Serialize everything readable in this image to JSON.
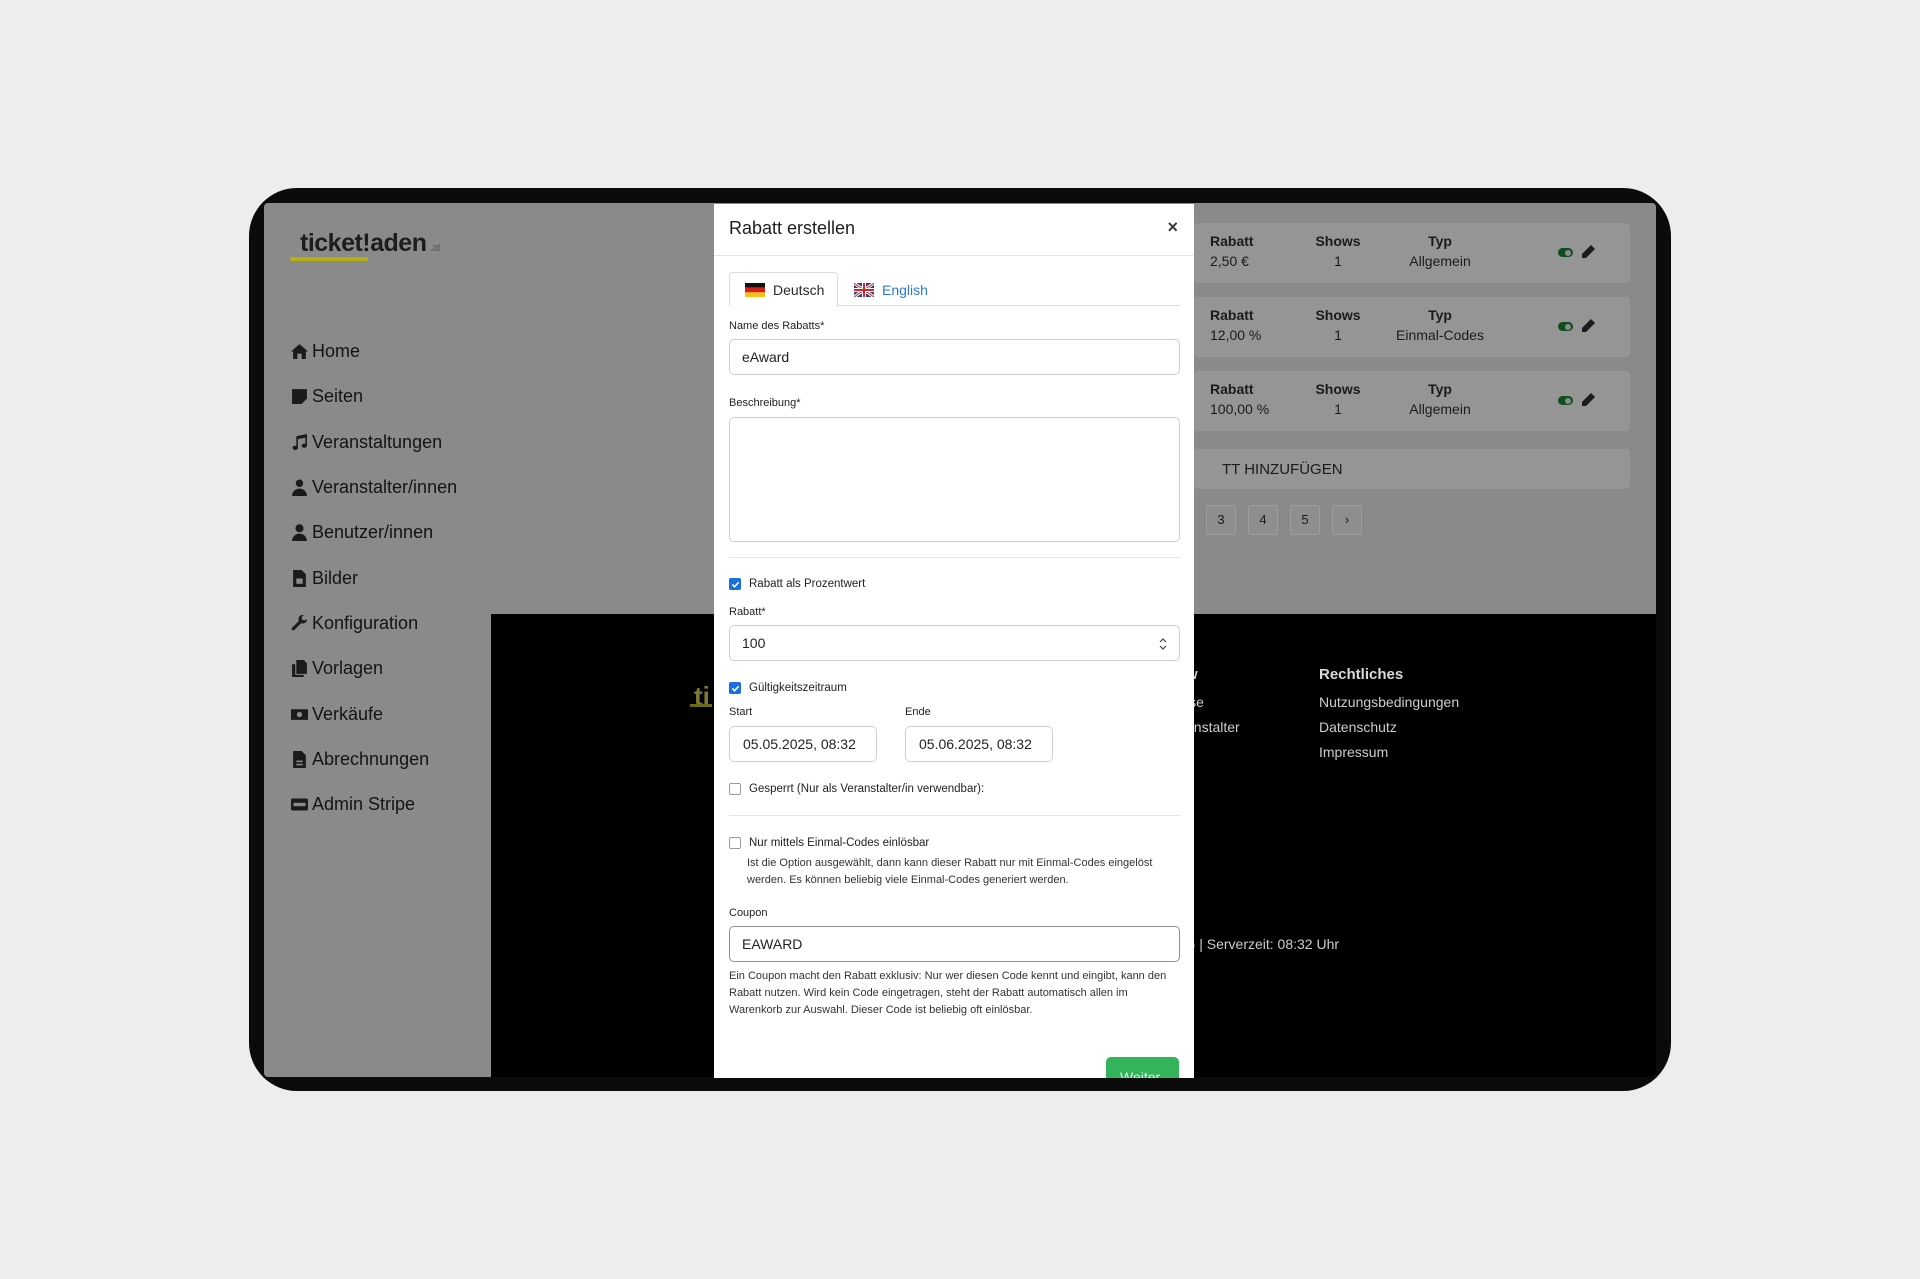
{
  "sidebar": {
    "logo": "ticket!aden",
    "logo_tld": ".at",
    "items": [
      {
        "label": "Home",
        "icon": "home-icon"
      },
      {
        "label": "Seiten",
        "icon": "sticky-note-icon"
      },
      {
        "label": "Veranstaltungen",
        "icon": "music-icon"
      },
      {
        "label": "Veranstalter/innen",
        "icon": "user-tie-icon"
      },
      {
        "label": "Benutzer/innen",
        "icon": "user-icon"
      },
      {
        "label": "Bilder",
        "icon": "file-image-icon"
      },
      {
        "label": "Konfiguration",
        "icon": "wrench-icon"
      },
      {
        "label": "Vorlagen",
        "icon": "copy-icon"
      },
      {
        "label": "Verkäufe",
        "icon": "money-bill-icon"
      },
      {
        "label": "Abrechnungen",
        "icon": "file-invoice-icon"
      },
      {
        "label": "Admin Stripe",
        "icon": "stripe-icon"
      }
    ]
  },
  "discounts": {
    "headers": {
      "rabatt": "Rabatt",
      "shows": "Shows",
      "typ": "Typ"
    },
    "rows": [
      {
        "rabatt": "2,50 €",
        "shows": "1",
        "typ": "Allgemein",
        "active": true
      },
      {
        "rabatt": "12,00 %",
        "shows": "1",
        "typ": "Einmal-Codes",
        "active": true
      },
      {
        "rabatt": "100,00 %",
        "shows": "1",
        "typ": "Allgemein",
        "active": true
      }
    ],
    "add_label": "TT HINZUFÜGEN",
    "pages": [
      "3",
      "4",
      "5",
      "›"
    ]
  },
  "footer": {
    "logo_fragment": "ti",
    "col_fragment_heading": "w",
    "col_fragment_links": [
      "ise",
      "anstalter"
    ],
    "legal_heading": "Rechtliches",
    "legal_links": [
      "Nutzungsbedingungen",
      "Datenschutz",
      "Impressum"
    ],
    "server_time": "r) | Serverzeit: 08:32 Uhr"
  },
  "modal": {
    "title": "Rabatt erstellen",
    "close": "×",
    "tabs": [
      {
        "label": "Deutsch",
        "active": true
      },
      {
        "label": "English",
        "active": false
      }
    ],
    "name_label": "Name des Rabatts*",
    "name_value": "eAward",
    "desc_label": "Beschreibung*",
    "desc_value": "",
    "percent_label": "Rabatt als Prozentwert",
    "percent_checked": true,
    "rabatt_label": "Rabatt*",
    "rabatt_value": "100",
    "validity_label": "Gültigkeitszeitraum",
    "validity_checked": true,
    "start_label": "Start",
    "start_value": "05.05.2025, 08:32",
    "end_label": "Ende",
    "end_value": "05.06.2025, 08:32",
    "locked_label": "Gesperrt (Nur als Veranstalter/in verwendbar):",
    "locked_checked": false,
    "onetime_label": "Nur mittels Einmal-Codes einlösbar",
    "onetime_checked": false,
    "onetime_help_1": "Ist die Option ausgewählt, dann kann dieser Rabatt nur mit Einmal-Codes eingelöst",
    "onetime_help_2": "werden. Es können beliebig viele Einmal-Codes generiert werden.",
    "coupon_label": "Coupon",
    "coupon_value": "EAWARD",
    "coupon_help_1": "Ein Coupon macht den Rabatt exklusiv: Nur wer diesen Code kennt und eingibt, kann den",
    "coupon_help_2": "Rabatt nutzen. Wird kein Code eingetragen, steht der Rabatt automatisch allen im",
    "coupon_help_3": "Warenkorb zur Auswahl. Dieser Code ist beliebig oft einlösbar.",
    "submit_label": "Weiter"
  },
  "colors": {
    "accent_green": "#33b35a",
    "link_blue": "#2a7bd6",
    "logo_yellow": "#b5b012"
  }
}
